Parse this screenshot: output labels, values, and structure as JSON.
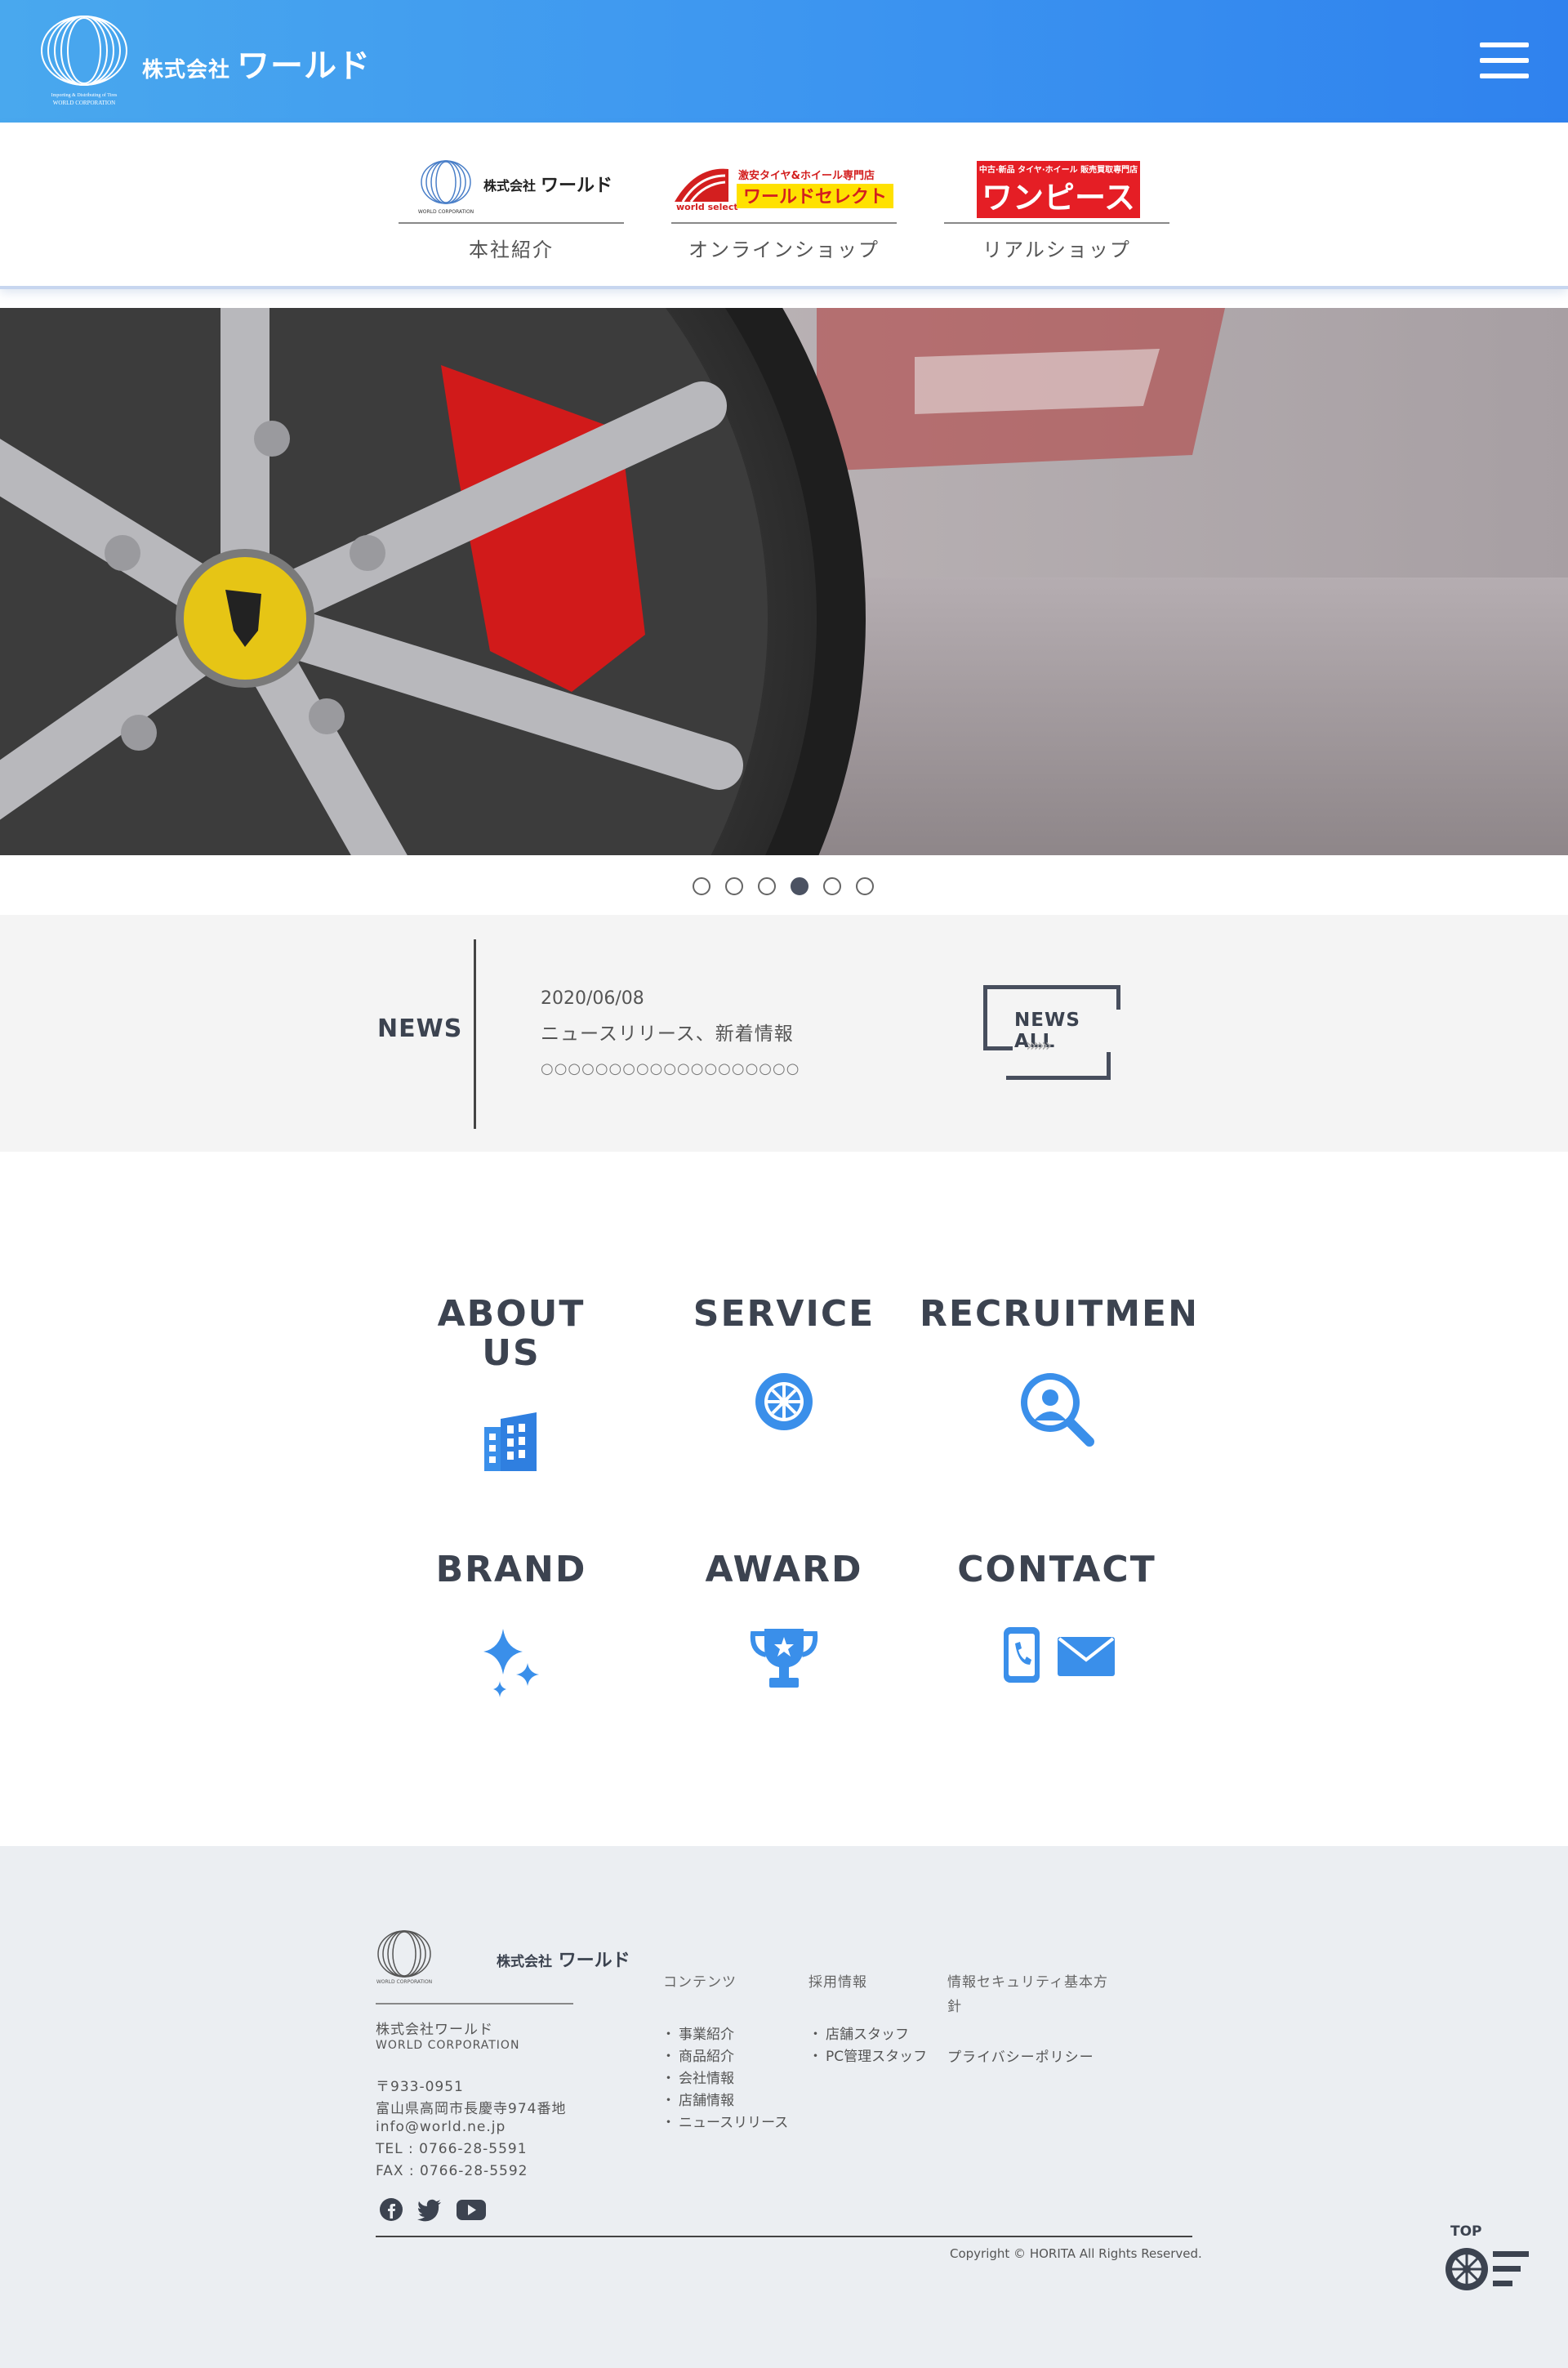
{
  "header": {
    "company_prefix": "株式会社",
    "company_name": "ワールド",
    "tagline": "Importing & Distributing of Tires",
    "corp_en": "WORLD CORPORATION",
    "accent_color": "#3d96f0"
  },
  "brands": [
    {
      "label": "本社紹介",
      "logo_prefix": "株式会社",
      "logo_name": "ワールド"
    },
    {
      "label": "オンラインショップ",
      "logo_top": "激安タイヤ&ホイール専門店",
      "logo_main": "ワールドセレクト",
      "logo_sub": "world select"
    },
    {
      "label": "リアルショップ",
      "logo_top": "中古·新品 タイヤ·ホイール 販売買取専門店",
      "logo_main": "ワンピース"
    }
  ],
  "slider": {
    "count": 6,
    "active_index": 3
  },
  "news": {
    "title": "NEWS",
    "date": "2020/06/08",
    "headline": "ニュースリリース、新着情報",
    "body": "○○○○○○○○○○○○○○○○○○○",
    "all_label": "NEWS ALL",
    "arrows": "»»»"
  },
  "menu": [
    {
      "title": "ABOUT US",
      "icon": "building-icon"
    },
    {
      "title": "SERVICE",
      "icon": "wheel-icon"
    },
    {
      "title": "RECRUITMENT",
      "icon": "person-search-icon"
    },
    {
      "title": "BRAND",
      "icon": "sparkle-icon"
    },
    {
      "title": "AWARD",
      "icon": "trophy-icon"
    },
    {
      "title": "CONTACT",
      "icon": "phone-mail-icon"
    }
  ],
  "footer": {
    "logo_prefix": "株式会社",
    "logo_name": "ワールド",
    "company_jp": "株式会社ワールド",
    "company_en": "WORLD CORPORATION",
    "postal": "〒933-0951",
    "address": "富山県高岡市長慶寺974番地",
    "email": "info@world.ne.jp",
    "tel": "TEL : 0766-28-5591",
    "fax": "FAX : 0766-28-5592",
    "contents_heading": "コンテンツ",
    "contents_items": [
      "事業紹介",
      "商品紹介",
      "会社情報",
      "店舗情報",
      "ニュースリリース"
    ],
    "recruit_heading": "採用情報",
    "recruit_items": [
      "店舗スタッフ",
      "PC管理スタッフ"
    ],
    "security_heading_1": "情報セキュリティ基本方",
    "security_heading_2": "針",
    "privacy": "プライバシーポリシー",
    "copyright": "Copyright © HORITA All Rights Reserved.",
    "top_label": "TOP"
  }
}
